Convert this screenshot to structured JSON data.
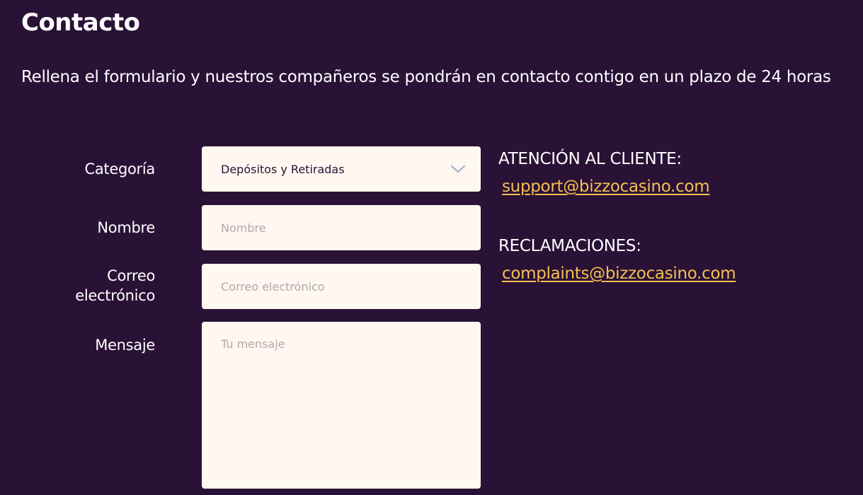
{
  "header": {
    "title": "Contacto",
    "description": "Rellena el formulario y nuestros compañeros se pondrán en contacto contigo en un plazo de 24 horas"
  },
  "form": {
    "category": {
      "label": "Categoría",
      "selected": "Depósitos y Retiradas",
      "icon": "chevron-down-icon"
    },
    "name": {
      "label": "Nombre",
      "placeholder": "Nombre"
    },
    "email": {
      "label_line1": "Correo",
      "label_line2": "electrónico",
      "placeholder": "Correo electrónico"
    },
    "message": {
      "label": "Mensaje",
      "placeholder": "Tu mensaje"
    }
  },
  "contacts": {
    "support": {
      "heading": "ATENCIÓN AL CLIENTE:",
      "email": "support@bizzocasino.com"
    },
    "complaints": {
      "heading": "RECLAMACIONES:",
      "email": "complaints@bizzocasino.com"
    }
  },
  "colors": {
    "background": "#2a1136",
    "field_background": "#fef8f0",
    "link": "#f4c150",
    "placeholder": "#b3a6ad"
  }
}
